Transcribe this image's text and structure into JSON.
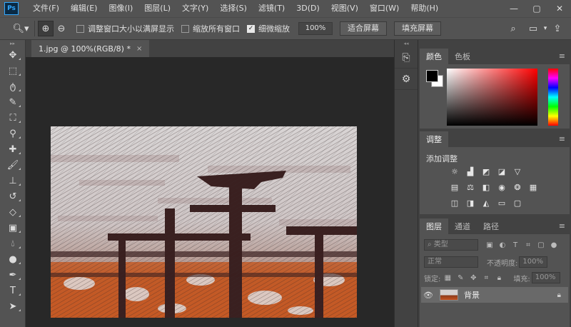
{
  "app": {
    "logo": "Ps"
  },
  "menu": [
    "文件(F)",
    "编辑(E)",
    "图像(I)",
    "图层(L)",
    "文字(Y)",
    "选择(S)",
    "滤镜(T)",
    "3D(D)",
    "视图(V)",
    "窗口(W)",
    "帮助(H)"
  ],
  "window_controls": {
    "minimize": "—",
    "maximize": "▢",
    "close": "✕"
  },
  "options": {
    "tool_icon": "zoom-icon",
    "resize_windows": "调整窗口大小以满屏显示",
    "resize_windows_checked": false,
    "zoom_all": "缩放所有窗口",
    "zoom_all_checked": false,
    "scrubby_zoom": "细微缩放",
    "scrubby_zoom_checked": true,
    "zoom_value": "100%",
    "fit_screen": "适合屏幕",
    "fill_screen": "填充屏幕"
  },
  "document": {
    "tab_title": "1.jpg @ 100%(RGB/8) *",
    "tab_close": "×"
  },
  "panels": {
    "color": {
      "tabs": [
        "颜色",
        "色板"
      ],
      "foreground": "#000000",
      "background": "#ffffff"
    },
    "adjustments": {
      "tab": "调整",
      "title": "添加调整"
    },
    "layers": {
      "tabs": [
        "图层",
        "通道",
        "路径"
      ],
      "filter_kind": "类型",
      "blend_mode": "正常",
      "opacity_label": "不透明度:",
      "opacity_value": "100%",
      "lock_label": "锁定:",
      "fill_label": "填充:",
      "fill_value": "100%",
      "layer_name": "背景"
    }
  },
  "colors": {
    "chrome": "#535353",
    "dark": "#424242",
    "canvas_bg": "#282828"
  }
}
